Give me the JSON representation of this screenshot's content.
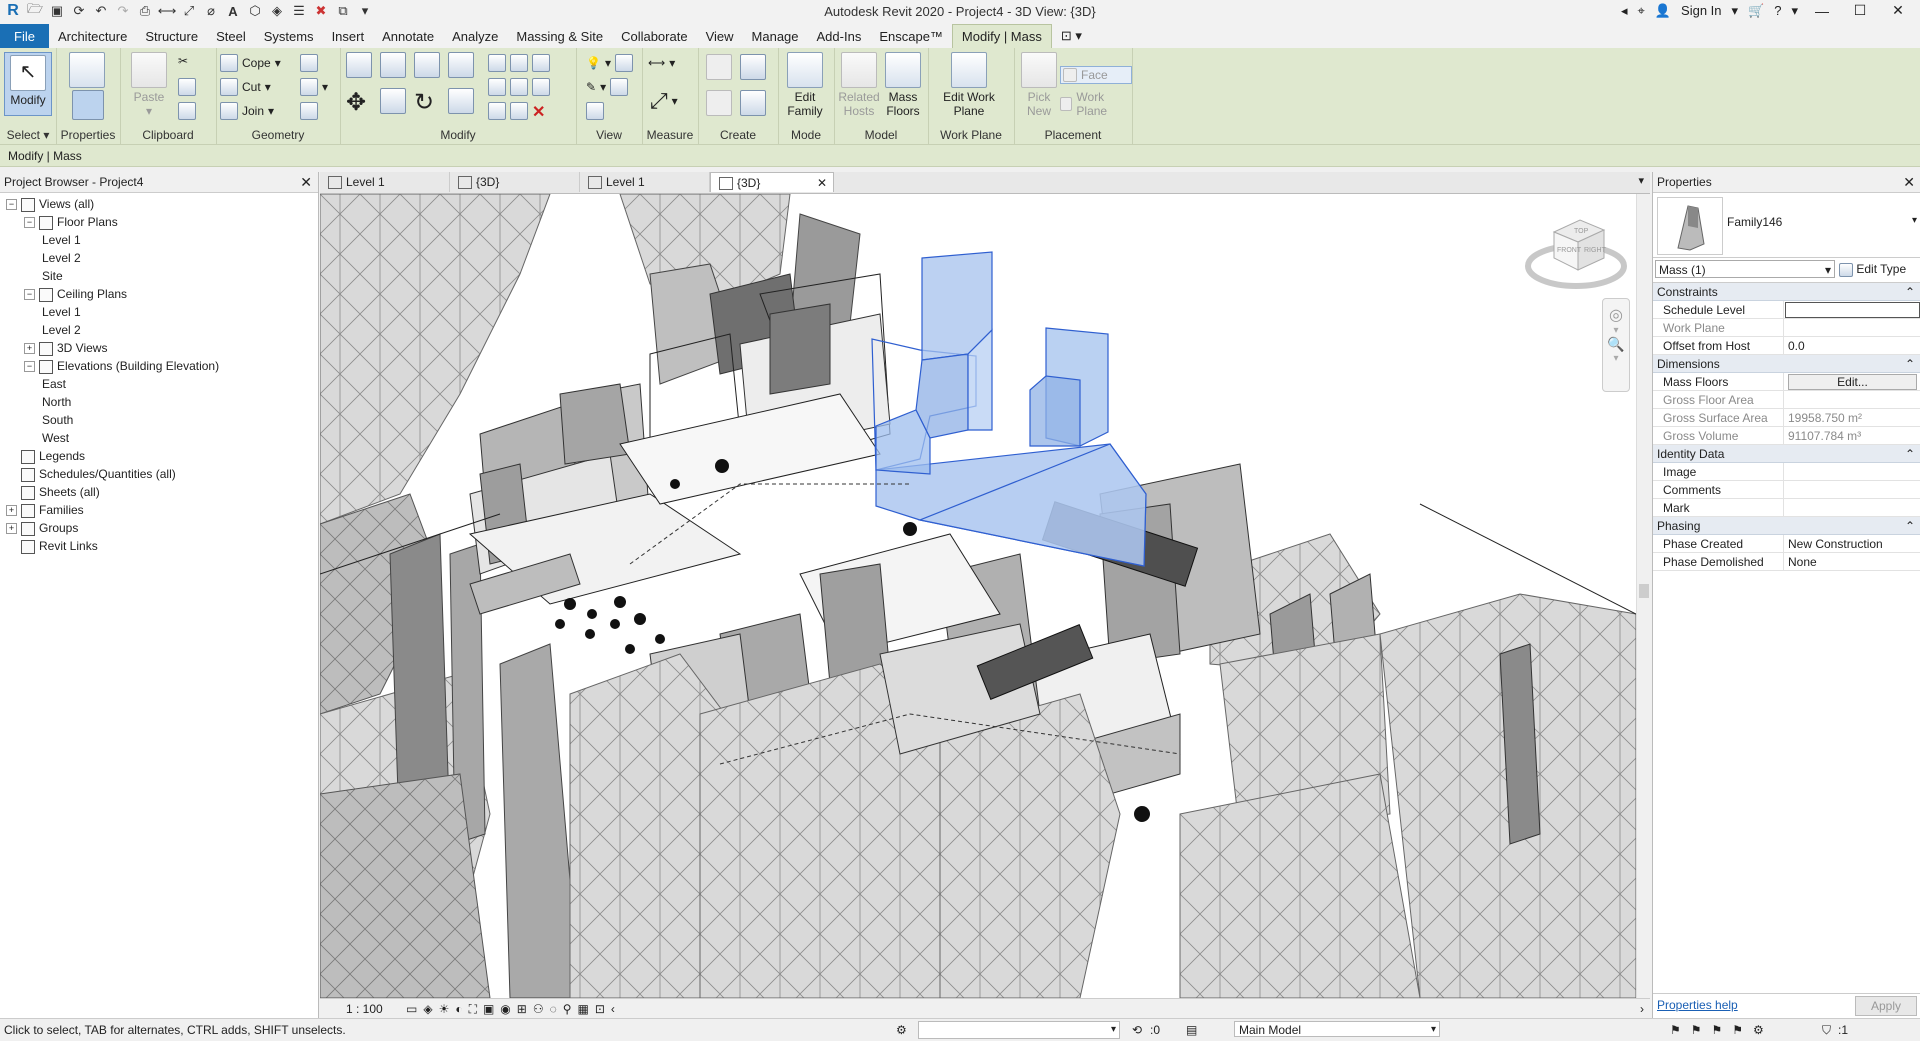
{
  "window": {
    "title": "Autodesk Revit 2020 - Project4 - 3D View: {3D}",
    "sign_in": "Sign In",
    "min": "—",
    "max": "☐",
    "close": "✕"
  },
  "ribbon_tabs": [
    "File",
    "Architecture",
    "Structure",
    "Steel",
    "Systems",
    "Insert",
    "Annotate",
    "Analyze",
    "Massing & Site",
    "Collaborate",
    "View",
    "Manage",
    "Add-Ins",
    "Enscape™",
    "Modify | Mass"
  ],
  "ribbon": {
    "select": {
      "modify": "Modify",
      "label": "Select"
    },
    "properties": {
      "label": "Properties"
    },
    "clipboard": {
      "paste": "Paste",
      "label": "Clipboard"
    },
    "geometry": {
      "cope": "Cope",
      "cut": "Cut",
      "join": "Join",
      "label": "Geometry"
    },
    "modify": {
      "label": "Modify"
    },
    "view": {
      "label": "View"
    },
    "measure": {
      "label": "Measure"
    },
    "create": {
      "label": "Create"
    },
    "mode": {
      "edit_family": "Edit Family",
      "label": "Mode"
    },
    "model": {
      "related_hosts": "Related Hosts",
      "mass_floors": "Mass Floors",
      "label": "Model"
    },
    "work_plane": {
      "edit_work_plane": "Edit Work Plane",
      "label": "Work Plane"
    },
    "placement": {
      "pick_new": "Pick New",
      "face": "Face",
      "work_plane": "Work Plane",
      "label": "Placement"
    }
  },
  "options_bar": {
    "context": "Modify | Mass"
  },
  "project_browser": {
    "title": "Project Browser - Project4",
    "items": [
      {
        "label": "Views (all)",
        "level": 0,
        "toggle": "−"
      },
      {
        "label": "Floor Plans",
        "level": 1,
        "toggle": "−"
      },
      {
        "label": "Level 1",
        "level": 2,
        "toggle": ""
      },
      {
        "label": "Level 2",
        "level": 2,
        "toggle": ""
      },
      {
        "label": "Site",
        "level": 2,
        "toggle": ""
      },
      {
        "label": "Ceiling Plans",
        "level": 1,
        "toggle": "−"
      },
      {
        "label": "Level 1",
        "level": 2,
        "toggle": ""
      },
      {
        "label": "Level 2",
        "level": 2,
        "toggle": ""
      },
      {
        "label": "3D Views",
        "level": 1,
        "toggle": "+"
      },
      {
        "label": "Elevations (Building Elevation)",
        "level": 1,
        "toggle": "−"
      },
      {
        "label": "East",
        "level": 2,
        "toggle": ""
      },
      {
        "label": "North",
        "level": 2,
        "toggle": ""
      },
      {
        "label": "South",
        "level": 2,
        "toggle": ""
      },
      {
        "label": "West",
        "level": 2,
        "toggle": ""
      },
      {
        "label": "Legends",
        "level": 0,
        "toggle": ""
      },
      {
        "label": "Schedules/Quantities (all)",
        "level": 0,
        "toggle": ""
      },
      {
        "label": "Sheets (all)",
        "level": 0,
        "toggle": ""
      },
      {
        "label": "Families",
        "level": 0,
        "toggle": "+"
      },
      {
        "label": "Groups",
        "level": 0,
        "toggle": "+"
      },
      {
        "label": "Revit Links",
        "level": 0,
        "toggle": ""
      }
    ]
  },
  "view_tabs": [
    {
      "label": "Level 1",
      "active": false
    },
    {
      "label": "{3D}",
      "active": false
    },
    {
      "label": "Level 1",
      "active": false
    },
    {
      "label": "{3D}",
      "active": true
    }
  ],
  "viewcube": {
    "top": "TOP",
    "front": "FRONT",
    "right": "RIGHT"
  },
  "view_bar": {
    "scale": "1 : 100"
  },
  "properties": {
    "title": "Properties",
    "family": "Family146",
    "selector": "Mass (1)",
    "edit_type": "Edit Type",
    "groups": [
      {
        "name": "Constraints",
        "rows": [
          {
            "k": "Schedule Level",
            "v": "",
            "disabled": false,
            "input": true
          },
          {
            "k": "Work Plane",
            "v": "",
            "disabled": true
          },
          {
            "k": "Offset from Host",
            "v": "0.0",
            "disabled": false
          }
        ]
      },
      {
        "name": "Dimensions",
        "rows": [
          {
            "k": "Mass Floors",
            "v": "Edit...",
            "disabled": false,
            "button": true
          },
          {
            "k": "Gross Floor Area",
            "v": "",
            "disabled": true
          },
          {
            "k": "Gross Surface Area",
            "v": "19958.750 m²",
            "disabled": true
          },
          {
            "k": "Gross Volume",
            "v": "91107.784 m³",
            "disabled": true
          }
        ]
      },
      {
        "name": "Identity Data",
        "rows": [
          {
            "k": "Image",
            "v": "",
            "disabled": false
          },
          {
            "k": "Comments",
            "v": "",
            "disabled": false
          },
          {
            "k": "Mark",
            "v": "",
            "disabled": false
          }
        ]
      },
      {
        "name": "Phasing",
        "rows": [
          {
            "k": "Phase Created",
            "v": "New Construction",
            "disabled": false
          },
          {
            "k": "Phase Demolished",
            "v": "None",
            "disabled": false
          }
        ]
      }
    ],
    "help": "Properties help",
    "apply": "Apply"
  },
  "status_bar": {
    "hint": "Click to select, TAB for alternates, CTRL adds, SHIFT unselects.",
    "count": ":0",
    "model": "Main Model",
    "filter": ":1"
  },
  "colors": {
    "ribbon": "#dfe8cf",
    "file_tab": "#1a6fb5",
    "selection": "#7aa6e6"
  }
}
